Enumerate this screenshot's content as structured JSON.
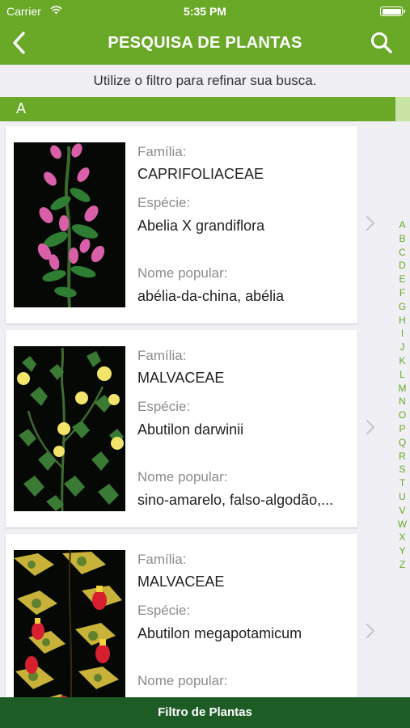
{
  "status_bar": {
    "carrier": "Carrier",
    "time": "5:35 PM"
  },
  "nav": {
    "title": "PESQUISA DE PLANTAS",
    "back_icon": "chevron-left-icon",
    "search_icon": "search-icon"
  },
  "hint": "Utilize o filtro para refinar sua busca.",
  "section": {
    "label": "A"
  },
  "plants": [
    {
      "family_label": "Família:",
      "family": "CAPRIFOLIACEAE",
      "species_label": "Espécie:",
      "species": "Abelia X grandiflora",
      "popular_label": "Nome popular:",
      "popular": "abélia-da-china, abélia"
    },
    {
      "family_label": "Família:",
      "family": "MALVACEAE",
      "species_label": "Espécie:",
      "species": "Abutilon darwinii",
      "popular_label": "Nome popular:",
      "popular": "sino-amarelo, falso-algodão,..."
    },
    {
      "family_label": "Família:",
      "family": "MALVACEAE",
      "species_label": "Espécie:",
      "species": "Abutilon megapotamicum",
      "popular_label": "Nome popular:",
      "popular": ""
    }
  ],
  "index_letters": [
    "A",
    "B",
    "C",
    "D",
    "E",
    "F",
    "G",
    "H",
    "I",
    "J",
    "K",
    "L",
    "M",
    "N",
    "O",
    "P",
    "Q",
    "R",
    "S",
    "T",
    "U",
    "V",
    "W",
    "X",
    "Y",
    "Z"
  ],
  "footer": {
    "label": "Filtro de Plantas"
  },
  "colors": {
    "brand_green": "#6aa928",
    "footer_green": "#1e5c26",
    "background": "#efeff4"
  }
}
